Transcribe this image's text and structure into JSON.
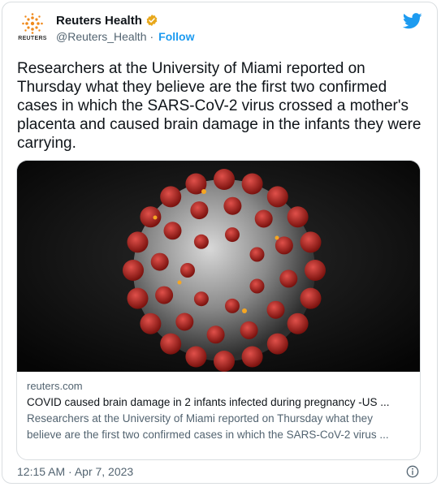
{
  "author": {
    "name": "Reuters Health",
    "handle": "@Reuters_Health",
    "separator": "·",
    "follow_label": "Follow",
    "avatar_wordmark": "REUTERS",
    "verified_color": "#e8a81c"
  },
  "tweet": {
    "text": "Researchers at the University of Miami reported on Thursday what they believe are the first two confirmed cases in which the SARS-CoV-2 virus crossed a mother's placenta and caused brain damage in the infants they were carrying."
  },
  "link_card": {
    "image_icon": "coronavirus-illustration",
    "domain": "reuters.com",
    "title": "COVID caused brain damage in 2 infants infected during pregnancy -US ...",
    "description": "Researchers at the University of Miami reported on Thursday what they believe are the first two confirmed cases in which the SARS-CoV-2 virus ..."
  },
  "footer": {
    "timestamp": "12:15 AM · Apr 7, 2023",
    "info_icon": "info-icon"
  },
  "colors": {
    "accent": "#1d9bf0",
    "secondary_text": "#536471",
    "virus_spike": "#b3261e"
  }
}
